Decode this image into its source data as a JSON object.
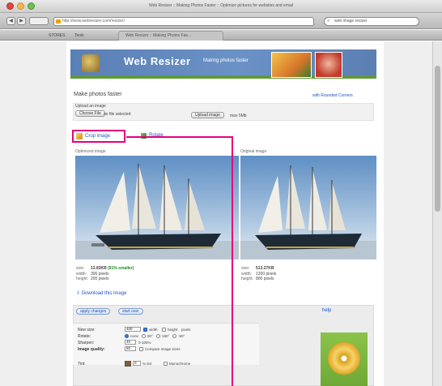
{
  "window": {
    "title": "Web Resizer :: Making Photos Faster :: Optimize pictures for websites and email"
  },
  "toolbar": {
    "url": "http://www.webresizer.com/resizer/",
    "search_value": "web image resizer",
    "back_glyph": "◀",
    "forward_glyph": "▶",
    "search_glyph": "⌕"
  },
  "bookmarks": {
    "items": [
      "STORES",
      "Tools"
    ],
    "tabs": [
      "Web Resizer :: Making Photos Fas..."
    ]
  },
  "banner": {
    "title": "Web Resizer",
    "tagline": "Making photos faster"
  },
  "section": {
    "title": "Make photos faster",
    "rounded_link": "with Rounded Corners"
  },
  "upload": {
    "label": "Upload an image",
    "choose_button": "Choose File",
    "no_file": "no file selected",
    "upload_button": "Upload image",
    "max_note": "max 5Mb"
  },
  "actions": {
    "crop": "Crop image",
    "rotate": "Rotate"
  },
  "images": {
    "optimized_label": "Optimized image",
    "original_label": "Original image"
  },
  "optimized_stats": [
    {
      "k": "size:",
      "v": "13.83KB",
      "note": "(91% smaller)"
    },
    {
      "k": "width:",
      "v": "300 pixels",
      "note": ""
    },
    {
      "k": "height:",
      "v": "200 pixels",
      "note": ""
    }
  ],
  "original_stats": [
    {
      "k": "size:",
      "v": "513.27KB",
      "note": ""
    },
    {
      "k": "width:",
      "v": "1200 pixels",
      "note": ""
    },
    {
      "k": "height:",
      "v": "800 pixels",
      "note": ""
    }
  ],
  "download": {
    "label": "Download this image",
    "glyph": "⇩"
  },
  "options": {
    "apply_button": "apply changes",
    "start_over_button": "start over",
    "help": "help",
    "new_size_label": "New size:",
    "new_size_value": "400",
    "width_opt": "width",
    "height_opt": "height",
    "pixels": "pixels",
    "rotate_label": "Rotate:",
    "rotate_opts": [
      "none",
      "90°",
      "180°",
      "-90°"
    ],
    "sharpen_label": "Sharpen:",
    "sharpen_value": "40",
    "sharpen_max": "0-100%",
    "quality_label": "Image quality:",
    "quality_value": "50",
    "compare_label": "Compare image sizes",
    "tint_label": "Tint:",
    "tint_value": "0",
    "tint_suffix": "% tint",
    "mono_label": "Monochrome"
  },
  "colors": {
    "annotation": "#e5007e",
    "link": "#1a55c8",
    "banner": "#5a7fb5",
    "savings": "#1a8a1a"
  }
}
